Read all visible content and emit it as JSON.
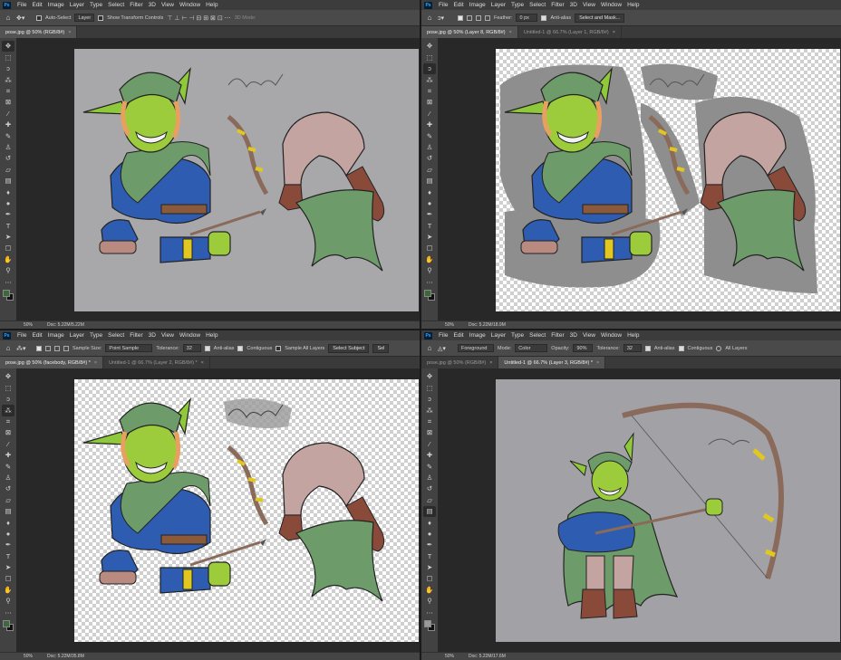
{
  "menu_items": [
    "File",
    "Edit",
    "Image",
    "Layer",
    "Type",
    "Select",
    "Filter",
    "3D",
    "View",
    "Window",
    "Help"
  ],
  "ps_logo": "Ps",
  "tool_icons": [
    "move-icon",
    "marquee-icon",
    "lasso-icon",
    "magic-wand-icon",
    "crop-icon",
    "frame-icon",
    "eyedropper-icon",
    "healing-icon",
    "brush-icon",
    "stamp-icon",
    "history-brush-icon",
    "eraser-icon",
    "gradient-icon",
    "blur-icon",
    "dodge-icon",
    "pen-icon",
    "type-icon",
    "path-select-icon",
    "shape-icon",
    "hand-icon",
    "zoom-icon",
    "more-icon"
  ],
  "panels": [
    {
      "options": {
        "auto_select_label": "Auto-Select",
        "auto_select_value": "Layer",
        "transform_controls_label": "Show Transform Controls",
        "mode_label": "3D Mode:"
      },
      "tabs": [
        {
          "label": "pose.jpg @ 50% (RGB/8#)",
          "active": true
        }
      ],
      "status": {
        "zoom": "50%",
        "doc": "Doc: 5.22M/5.22M"
      },
      "document": "photo",
      "selected_tool": 0,
      "fg_color": "#3a6a3a"
    },
    {
      "options": {
        "feather_label": "Feather:",
        "feather_value": "0 px",
        "antialias_label": "Anti-alias",
        "select_mask_label": "Select and Mask..."
      },
      "tabs": [
        {
          "label": "pose.jpg @ 50% (Layer 8, RGB/8#)",
          "active": true
        },
        {
          "label": "Untitled-1 @ 66.7% (Layer 1, RGB/8#)",
          "active": false
        }
      ],
      "status": {
        "zoom": "50%",
        "doc": "Doc: 5.22M/18.9M"
      },
      "document": "cutout-gray",
      "selected_tool": 2,
      "fg_color": "#3a6a3a"
    },
    {
      "options": {
        "sample_size_label": "Sample Size:",
        "sample_size_value": "Point Sample",
        "tolerance_label": "Tolerance:",
        "tolerance_value": "32",
        "antialias_label": "Anti-alias",
        "contiguous_label": "Contiguous",
        "sample_all_label": "Sample All Layers",
        "select_subject_label": "Select Subject",
        "select_mask_label": "Sel"
      },
      "tabs": [
        {
          "label": "pose.jpg @ 50% (facebody, RGB/8#) *",
          "active": true
        },
        {
          "label": "Untitled-1 @ 66.7% (Layer 2, RGB/8#) *",
          "active": false
        }
      ],
      "status": {
        "zoom": "50%",
        "doc": "Doc: 5.22M/35.8M"
      },
      "document": "cutout-clean",
      "selected_tool": 3,
      "fg_color": "#3a6a3a"
    },
    {
      "options": {
        "fill_value": "Foreground",
        "mode_label": "Mode:",
        "mode_value": "Color",
        "opacity_label": "Opacity:",
        "opacity_value": "90%",
        "tolerance_label": "Tolerance:",
        "tolerance_value": "32",
        "antialias_label": "Anti-alias",
        "contiguous_label": "Contiguous",
        "all_layers_label": "All Layers"
      },
      "tabs": [
        {
          "label": "pose.jpg @ 50% (RGB/8#)",
          "active": false
        },
        {
          "label": "Untitled-1 @ 66.7% (Layer 3, RGB/8#) *",
          "active": true
        }
      ],
      "status": {
        "zoom": "50%",
        "doc": "Doc: 5.22M/17.6M"
      },
      "document": "posed",
      "selected_tool": 12,
      "fg_color": "#9a9a9a"
    }
  ]
}
